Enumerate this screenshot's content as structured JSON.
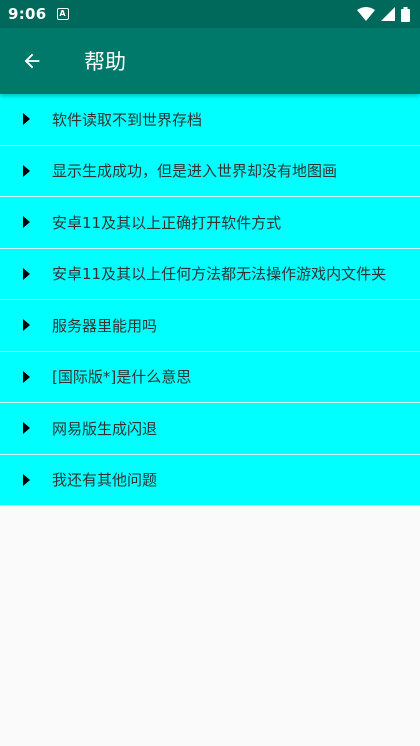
{
  "status_bar": {
    "time": "9:06",
    "notification_icon_letter": "A",
    "icons": [
      "wifi-icon",
      "signal-icon",
      "battery-icon"
    ]
  },
  "app_bar": {
    "title": "帮助",
    "back_icon": "arrow-back-icon",
    "color": "#00796B"
  },
  "help_items": [
    {
      "label": "软件读取不到世界存档"
    },
    {
      "label": "显示生成成功，但是进入世界却没有地图画"
    },
    {
      "label": "安卓11及其以上正确打开软件方式"
    },
    {
      "label": "安卓11及其以上任何方法都无法操作游戏内文件夹"
    },
    {
      "label": "服务器里能用吗"
    },
    {
      "label": "[国际版*]是什么意思"
    },
    {
      "label": "网易版生成闪退"
    },
    {
      "label": "我还有其他问题"
    }
  ],
  "colors": {
    "status_bar": "#00695C",
    "item_background": "#00FFFF",
    "page_background": "#FAFAFA"
  }
}
